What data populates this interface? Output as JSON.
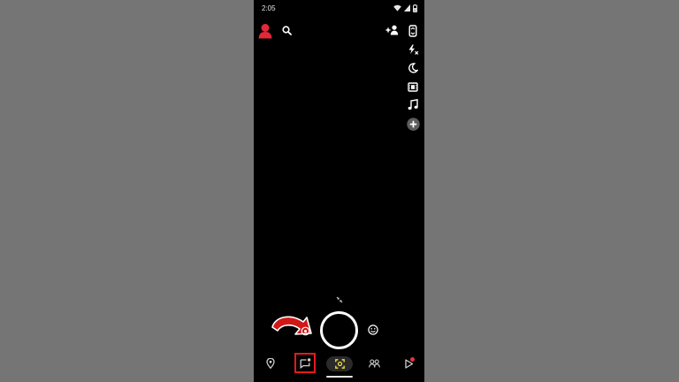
{
  "status_bar": {
    "time": "2:05"
  },
  "top_bar": {
    "avatar_icon": "avatar-icon",
    "search_icon": "search-icon",
    "add_friend_icon": "add-friend-icon"
  },
  "side_toolbar": {
    "items": [
      "flip-camera-icon",
      "flash-off-icon",
      "night-mode-icon",
      "video-filmstrip-icon",
      "music-note-icon",
      "plus-circle-icon"
    ]
  },
  "bottom_nav": {
    "items": [
      "map-pin-icon",
      "chat-icon",
      "camera-scan-icon",
      "friends-icon",
      "stories-play-icon"
    ],
    "active": "camera-scan-icon",
    "highlighted": "chat-icon"
  },
  "colors": {
    "background": "#757575",
    "phone": "#000000",
    "accent_yellow": "#f7e23a",
    "highlight_red": "#e31b1b",
    "notification_red": "#e8353b"
  }
}
